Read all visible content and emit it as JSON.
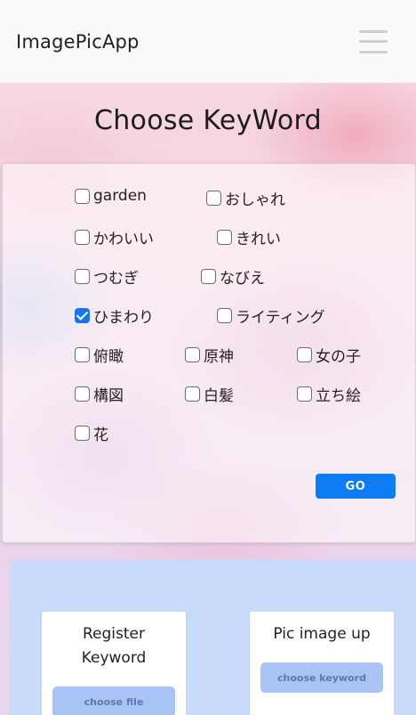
{
  "navbar": {
    "brand": "ImagePicApp",
    "menu_icon": "hamburger-menu-icon"
  },
  "title": "Choose KeyWord",
  "keywords": [
    {
      "label": "garden",
      "checked": false
    },
    {
      "label": "おしゃれ",
      "checked": false
    },
    {
      "label": "かわいい",
      "checked": false
    },
    {
      "label": "きれい",
      "checked": false
    },
    {
      "label": "つむぎ",
      "checked": false
    },
    {
      "label": "なびえ",
      "checked": false
    },
    {
      "label": "ひまわり",
      "checked": true
    },
    {
      "label": "ライティング",
      "checked": false
    },
    {
      "label": "俯瞰",
      "checked": false
    },
    {
      "label": "原神",
      "checked": false
    },
    {
      "label": "女の子",
      "checked": false
    },
    {
      "label": "構図",
      "checked": false
    },
    {
      "label": "白髪",
      "checked": false
    },
    {
      "label": "立ち絵",
      "checked": false
    },
    {
      "label": "花",
      "checked": false
    }
  ],
  "go_label": "GO",
  "register": {
    "title_line1": "Register",
    "title_line2": "Keyword",
    "button": "choose file"
  },
  "picimage": {
    "title": "Pic image up",
    "button": "choose keyword"
  },
  "colors": {
    "accent": "#0d7bf2",
    "bottom_panel": "#c9dbfa",
    "sub_button": "#a9c4f4"
  }
}
